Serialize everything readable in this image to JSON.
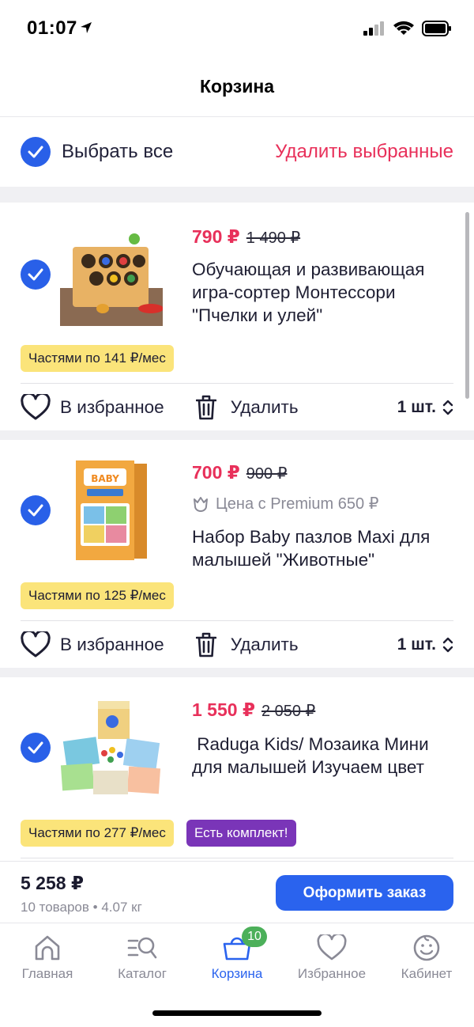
{
  "status": {
    "time": "01:07"
  },
  "nav": {
    "title": "Корзина"
  },
  "select_bar": {
    "select_all": "Выбрать все",
    "delete_selected": "Удалить выбранные"
  },
  "items": [
    {
      "price": "790 ₽",
      "old_price": "1 490 ₽",
      "title": "Обучающая и развивающая игра-сортер Монтессори \"Пчелки и улей\"",
      "installment": "Частями по 141 ₽/мес",
      "favorite": "В избранное",
      "delete": "Удалить",
      "qty": "1 шт.",
      "selected": true
    },
    {
      "price": "700 ₽",
      "old_price": "900 ₽",
      "premium": "Цена с Premium 650 ₽",
      "title": "Набор Baby пазлов Maxi для малышей \"Животные\"",
      "installment": "Частями по 125 ₽/мес",
      "favorite": "В избранное",
      "delete": "Удалить",
      "qty": "1 шт.",
      "selected": true
    },
    {
      "price": "1 550 ₽",
      "old_price": "2 050 ₽",
      "title": " Raduga Kids/ Мозаика Мини для малышей Изучаем цвет",
      "installment": "Частями по 277 ₽/мес",
      "set_badge": "Есть комплект!",
      "selected": true
    }
  ],
  "footer": {
    "total": "5 258 ₽",
    "summary": "10 товаров • 4.07 кг",
    "checkout": "Оформить заказ"
  },
  "tabbar": {
    "tabs": [
      {
        "label": "Главная",
        "icon": "home-icon"
      },
      {
        "label": "Каталог",
        "icon": "catalog-search-icon"
      },
      {
        "label": "Корзина",
        "icon": "basket-icon",
        "badge": "10",
        "active": true
      },
      {
        "label": "Избранное",
        "icon": "heart-icon"
      },
      {
        "label": "Кабинет",
        "icon": "smiley-face-icon"
      }
    ]
  },
  "colors": {
    "accent": "#2a63ee",
    "price": "#e8305a",
    "installment_tag": "#fbe47a",
    "set_tag": "#7a35b8",
    "cart_badge": "#4cb05a"
  }
}
